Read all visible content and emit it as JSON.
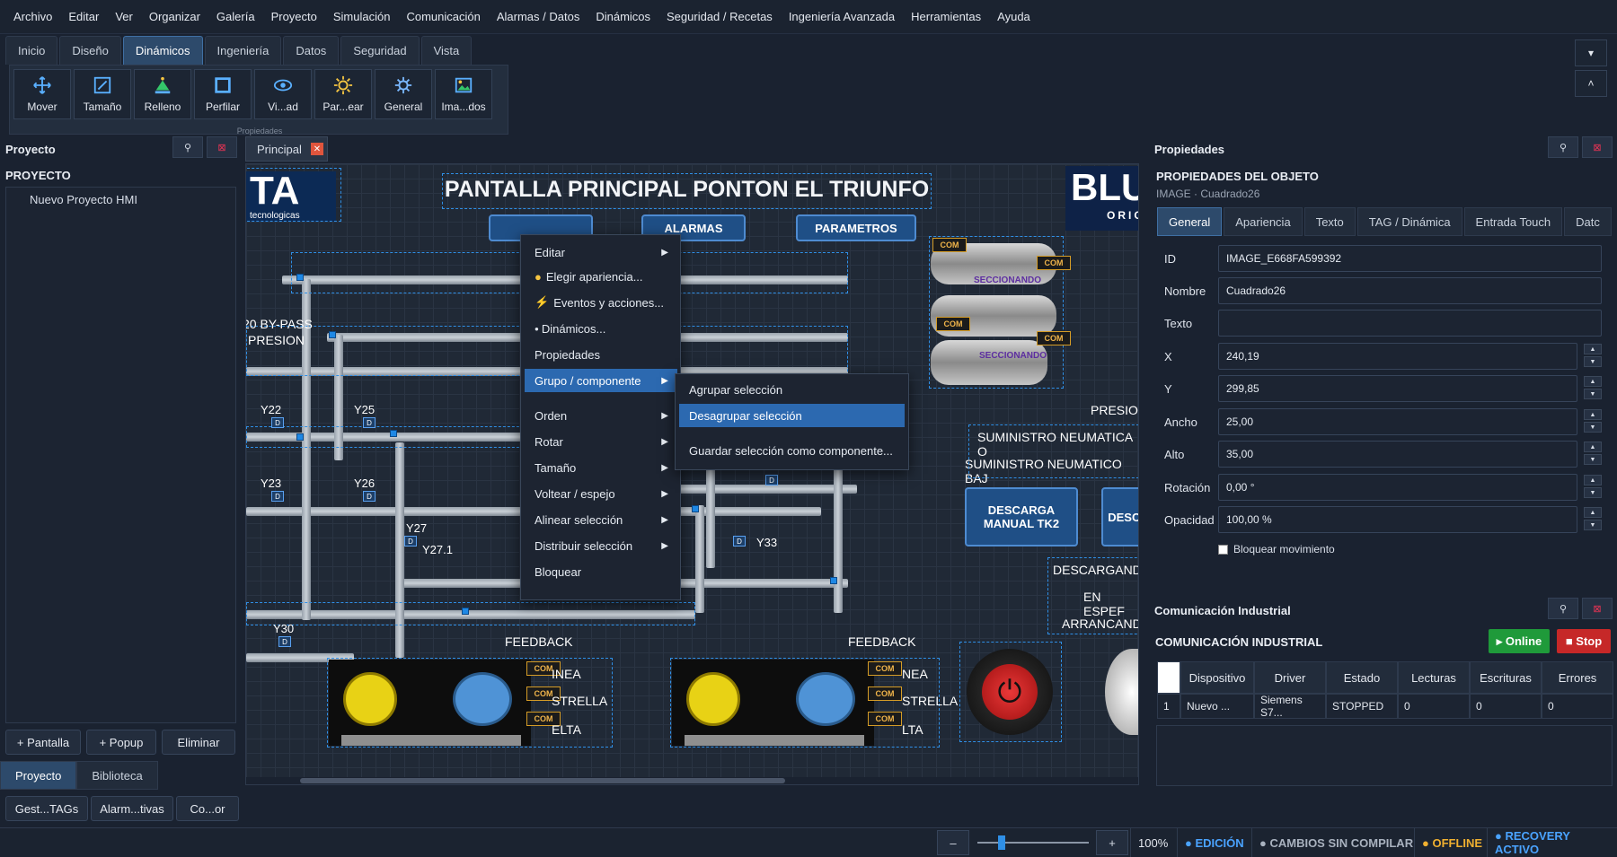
{
  "menubar": [
    "Archivo",
    "Editar",
    "Ver",
    "Organizar",
    "Galería",
    "Proyecto",
    "Simulación",
    "Comunicación",
    "Alarmas / Datos",
    "Dinámicos",
    "Seguridad / Recetas",
    "Ingeniería Avanzada",
    "Herramientas",
    "Ayuda"
  ],
  "tabs": [
    "Inicio",
    "Diseño",
    "Dinámicos",
    "Ingeniería",
    "Datos",
    "Seguridad",
    "Vista"
  ],
  "ribbon": {
    "buttons": [
      {
        "label": "Mover",
        "icon": "move-icon"
      },
      {
        "label": "Tamaño",
        "icon": "resize-icon"
      },
      {
        "label": "Relleno",
        "icon": "fill-icon"
      },
      {
        "label": "Perfilar",
        "icon": "outline-icon"
      },
      {
        "label": "Vi...ad",
        "icon": "eye-icon"
      },
      {
        "label": "Par...ear",
        "icon": "blink-icon"
      },
      {
        "label": "General",
        "icon": "gear-sun-icon"
      },
      {
        "label": "Ima...dos",
        "icon": "image-icon"
      }
    ],
    "group_label": "Propiedades",
    "collapse_down": "▾",
    "collapse_up": "˄"
  },
  "left_panel": {
    "header": "Proyecto",
    "title": "PROYECTO",
    "tree_item": "Nuevo Proyecto HMI",
    "buttons": [
      "+ Pantalla",
      "+ Popup",
      "Eliminar"
    ],
    "bottom_tabs": [
      "Proyecto",
      "Biblioteca"
    ],
    "bottom_buttons": [
      "Gest...TAGs",
      "Alarm...tivas",
      "Co...or"
    ]
  },
  "canvas": {
    "tab": "Principal",
    "logo_left": "TA",
    "logo_left_sub": "tecnologicas",
    "logo_right": "BLU",
    "logo_right_sub": "ORIG",
    "title": "PANTALLA PRINCIPAL PONTON EL TRIUNFO",
    "nav_buttons": [
      "ALARMAS",
      "PARAMETROS"
    ],
    "bypass_label": "20 BY-PASS",
    "presion_label": "PRESION",
    "valves": [
      "Y22",
      "Y25",
      "Y23",
      "Y26",
      "Y27",
      "Y27.1",
      "Y30",
      "Y33"
    ],
    "com": "COM",
    "status_texts": [
      "SECCIONANDO",
      "SECCIONANDO"
    ],
    "right_labels": [
      "PRESION",
      "SUMINISTRO NEUMATICA O",
      "SUMINISTRO NEUMATICO BAJ"
    ],
    "discharge_buttons": [
      "DESCARGA MANUAL TK2",
      "DESCA"
    ],
    "state_labels": [
      "DESCARGAND",
      "EN ESPEF",
      "ARRANCAND"
    ],
    "feedback": "FEEDBACK",
    "motor_labels": [
      "INEA",
      "STRELLA",
      "ELTA"
    ],
    "motor_labels2": [
      "NEA",
      "STRELLA",
      "LTA"
    ]
  },
  "context_menu": {
    "items": [
      {
        "label": "Editar",
        "submenu": true
      },
      {
        "label": "Elegir apariencia...",
        "icon": "palette-icon"
      },
      {
        "label": "Eventos y acciones...",
        "icon": "bolt-icon"
      },
      {
        "label": "Dinámicos...",
        "icon": "dot-icon"
      },
      {
        "label": "Propiedades"
      },
      {
        "label": "Grupo / componente",
        "submenu": true,
        "highlight": true
      },
      {
        "label": "Orden",
        "submenu": true
      },
      {
        "label": "Rotar",
        "submenu": true
      },
      {
        "label": "Tamaño",
        "submenu": true
      },
      {
        "label": "Voltear / espejo",
        "submenu": true
      },
      {
        "label": "Alinear selección",
        "submenu": true
      },
      {
        "label": "Distribuir selección",
        "submenu": true
      },
      {
        "label": "Bloquear"
      }
    ],
    "submenu": [
      "Agrupar selección",
      "Desagrupar selección",
      "Guardar selección como componente..."
    ]
  },
  "properties": {
    "header": "Propiedades",
    "title": "PROPIEDADES DEL OBJETO",
    "subtitle": "IMAGE  ·  Cuadrado26",
    "tabs": [
      "General",
      "Apariencia",
      "Texto",
      "TAG / Dinámica",
      "Entrada Touch",
      "Datc"
    ],
    "fields": [
      {
        "label": "ID",
        "value": "IMAGE_E668FA599392"
      },
      {
        "label": "Nombre",
        "value": "Cuadrado26"
      },
      {
        "label": "Texto",
        "value": ""
      },
      {
        "label": "X",
        "value": "240,19"
      },
      {
        "label": "Y",
        "value": "299,85"
      },
      {
        "label": "Ancho",
        "value": "25,00"
      },
      {
        "label": "Alto",
        "value": "35,00"
      },
      {
        "label": "Rotación",
        "value": "0,00 °"
      },
      {
        "label": "Opacidad",
        "value": "100,00 %"
      }
    ],
    "lock_label": "Bloquear movimiento"
  },
  "comm": {
    "header": "Comunicación Industrial",
    "title": "COMUNICACIÓN INDUSTRIAL",
    "online": "▸ Online",
    "stop": "■ Stop",
    "columns": [
      "Dispositivo",
      "Driver",
      "Estado",
      "Lecturas",
      "Escrituras",
      "Errores"
    ],
    "row": [
      "1",
      "Nuevo ...",
      "Siemens S7...",
      "STOPPED",
      "0",
      "0",
      "0"
    ]
  },
  "statusbar": {
    "zoom_minus": "–",
    "zoom_plus": "+",
    "zoom": "100%",
    "zoom_level": 0.2,
    "items": [
      {
        "text": "● EDICIÓN",
        "color": "#4aa3ff"
      },
      {
        "text": "● CAMBIOS SIN COMPILAR",
        "color": "#a9b2bf"
      },
      {
        "text": "● OFFLINE",
        "color": "#f0b030"
      },
      {
        "text": "● RECOVERY ACTIVO",
        "color": "#4aa3ff"
      }
    ]
  },
  "colors": {
    "accent": "#2c69b0",
    "online": "#1f9a3a",
    "stop": "#c62828"
  }
}
